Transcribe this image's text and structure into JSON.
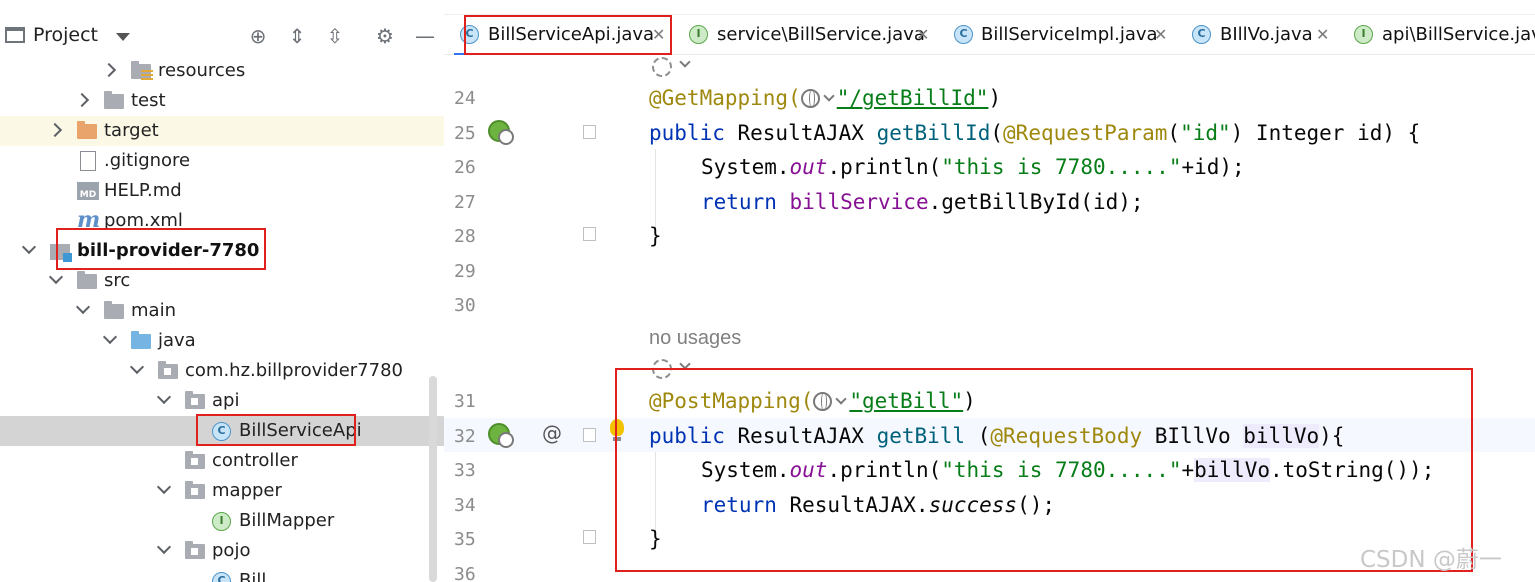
{
  "project_panel": {
    "title": "Project",
    "tree": [
      {
        "label": "resources",
        "kind": "folder-res",
        "state": "collapsed"
      },
      {
        "label": "test",
        "kind": "folder",
        "state": "collapsed"
      },
      {
        "label": "target",
        "kind": "folder-orange",
        "state": "collapsed"
      },
      {
        "label": ".gitignore",
        "kind": "file"
      },
      {
        "label": "HELP.md",
        "kind": "md"
      },
      {
        "label": "pom.xml",
        "kind": "maven"
      },
      {
        "label": "bill-provider-7780",
        "kind": "module",
        "state": "expanded"
      },
      {
        "label": "src",
        "kind": "folder",
        "state": "expanded"
      },
      {
        "label": "main",
        "kind": "folder",
        "state": "expanded"
      },
      {
        "label": "java",
        "kind": "folder-blue",
        "state": "expanded"
      },
      {
        "label": "com.hz.billprovider7780",
        "kind": "package",
        "state": "expanded"
      },
      {
        "label": "api",
        "kind": "package",
        "state": "expanded"
      },
      {
        "label": "BillServiceApi",
        "kind": "class",
        "selected": true
      },
      {
        "label": "controller",
        "kind": "package"
      },
      {
        "label": "mapper",
        "kind": "package",
        "state": "expanded"
      },
      {
        "label": "BillMapper",
        "kind": "interface"
      },
      {
        "label": "pojo",
        "kind": "package",
        "state": "expanded"
      },
      {
        "label": "Bill",
        "kind": "class"
      }
    ]
  },
  "tabs": [
    {
      "label": "BillServiceApi.java",
      "icon": "class-icon",
      "active": true
    },
    {
      "label": "service\\BillService.java",
      "icon": "interface-icon"
    },
    {
      "label": "BillServiceImpl.java",
      "icon": "class-icon"
    },
    {
      "label": "BIllVo.java",
      "icon": "class-icon"
    },
    {
      "label": "api\\BillService.java",
      "icon": "interface-icon"
    }
  ],
  "editor": {
    "line_numbers": [
      "24",
      "25",
      "26",
      "27",
      "28",
      "29",
      "30",
      "31",
      "32",
      "33",
      "34",
      "35",
      "36"
    ],
    "usage_hint": "no usages",
    "code": {
      "l24_ann": "@GetMapping(",
      "l24_str": "\"/getBillId\"",
      "l24_end": ")",
      "l25_kw": "public",
      "l25_type": " ResultAJAX ",
      "l25_meth": "getBillId",
      "l25_open": "(",
      "l25_ann": "@RequestParam",
      "l25_po": "(",
      "l25_str": "\"id\"",
      "l25_rest": ") Integer id) {",
      "l26_a": "System.",
      "l26_field": "out",
      "l26_b": ".println(",
      "l26_str": "\"this is 7780.....\"",
      "l26_c": "+id);",
      "l27_kw": "return",
      "l27_sp": " ",
      "l27_field": "billService",
      "l27_rest": ".getBillById(id);",
      "l28": "}",
      "l31_ann": "@PostMapping(",
      "l31_str": "\"getBill\"",
      "l31_end": ")",
      "l32_kw": "public",
      "l32_type": " ResultAJAX ",
      "l32_meth": "getBill",
      "l32_open": " (",
      "l32_ann": "@RequestBody",
      "l32_type2": " BIllVo ",
      "l32_param": "billVo",
      "l32_end": "){",
      "l33_a": "System.",
      "l33_field": "out",
      "l33_b": ".println(",
      "l33_str": "\"this is 7780.....\"",
      "l33_plus": "+",
      "l33_param": "billVo",
      "l33_c": ".toString());",
      "l34_kw": "return",
      "l34_a": " ResultAJAX.",
      "l34_stat": "success",
      "l34_b": "();",
      "l35": "}"
    }
  },
  "watermark": "CSDN @蔚一",
  "colors": {
    "keyword": "#0033b3",
    "annotation": "#9e880d",
    "string": "#067d17",
    "method": "#00627a",
    "field": "#871094",
    "highlight_box": "#e0201d"
  }
}
